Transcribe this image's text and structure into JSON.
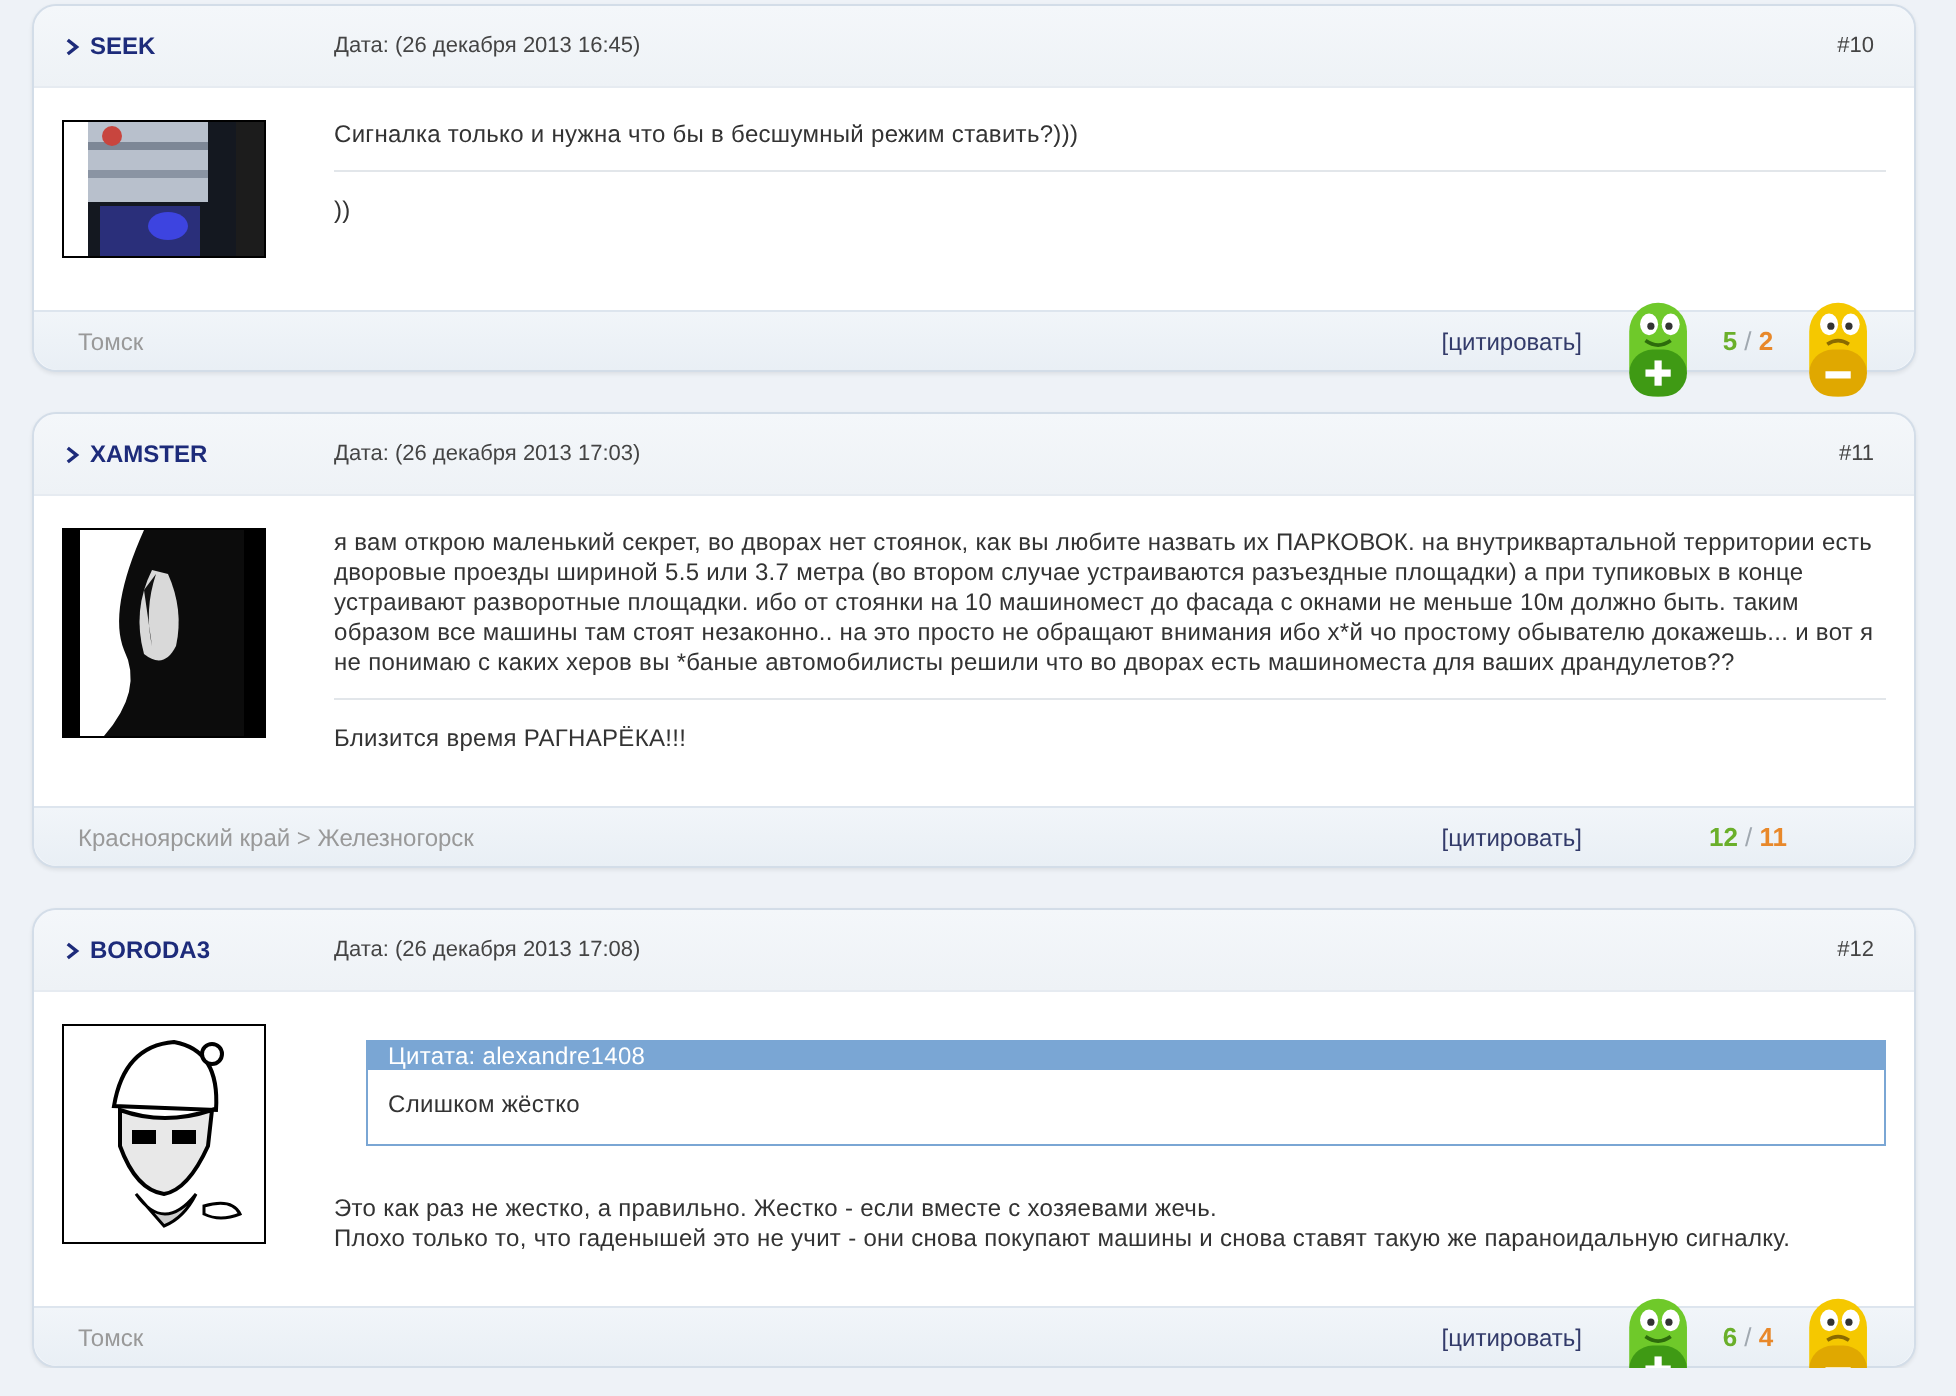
{
  "posts": [
    {
      "author": "SEEK",
      "date": "Дата: (26 декабря 2013 16:45)",
      "number": "#10",
      "message": [
        "Сигналка только и нужна что бы в бесшумный режим ставить?)))"
      ],
      "signature": "))",
      "location": "Томск",
      "quote_link": "[цитировать]",
      "votes_up": "5",
      "votes_sep": "/",
      "votes_down": "2",
      "vote_buttons": true
    },
    {
      "author": "XAMSTER",
      "date": "Дата: (26 декабря 2013 17:03)",
      "number": "#11",
      "message": [
        "я вам открою маленький секрет, во дворах нет стоянок, как вы любите назвать их ПАРКОВОК. на внутриквартальной территории есть дворовые проезды шириной 5.5 или 3.7 метра (во втором случае устраиваются разъездные площадки) а при тупиковых в конце устраивают разворотные площадки. ибо от стоянки на 10 машиномест до фасада с окнами не меньше 10м должно быть. таким образом все машины там стоят незаконно.. на это просто не обращают внимания ибо х*й чо простому обывателю докажешь... и вот я не понимаю с каких херов вы *баные автомобилисты решили что во дворах есть машиноместа для ваших драндулетов??"
      ],
      "signature": "Близится время РАГНАРЁКА!!!",
      "location": "Красноярский край > Железногорск",
      "quote_link": "[цитировать]",
      "votes_up": "12",
      "votes_sep": "/",
      "votes_down": "11",
      "vote_buttons": false
    },
    {
      "author": "BORODA3",
      "date": "Дата: (26 декабря 2013 17:08)",
      "number": "#12",
      "quote": {
        "title": "Цитата: alexandre1408",
        "text": "Слишком жёстко"
      },
      "message": [
        "Это как раз не жестко, а правильно. Жестко - если вместе с хозяевами жечь.",
        "Плохо только то, что гаденышей это не учит - они снова покупают машины и снова ставят такую же параноидальную сигналку."
      ],
      "location": "Томск",
      "quote_link": "[цитировать]",
      "votes_up": "6",
      "votes_sep": "/",
      "votes_down": "4",
      "vote_buttons": true
    }
  ]
}
